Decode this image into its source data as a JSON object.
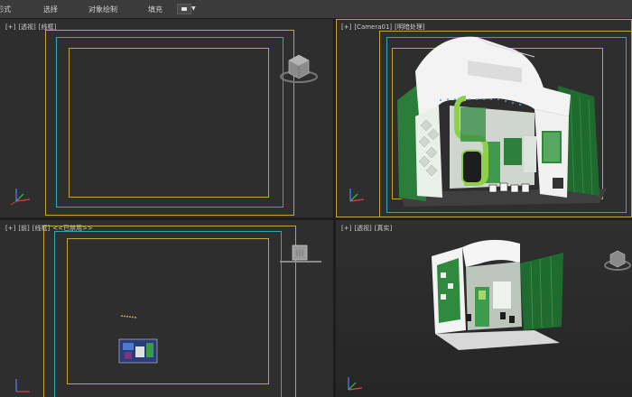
{
  "ribbon": {
    "tabs": [
      "形式",
      "选择",
      "对象绘制",
      "填充"
    ]
  },
  "viewports": {
    "top_left": {
      "labels": [
        "[+]",
        "[透视]",
        "[线框]"
      ]
    },
    "top_right": {
      "labels": [
        "[+]",
        "[Camera01]",
        "[明暗处理]"
      ]
    },
    "bottom_left": {
      "labels": [
        "[+]",
        "[前]",
        "[线框]",
        "<<已禁用>>"
      ]
    },
    "bottom_right": {
      "labels": [
        "[+]",
        "[透视]",
        "[真实]"
      ]
    }
  },
  "colors": {
    "safe_frame": "#c9a23a",
    "action_safe": "#2ba9b9",
    "booth_green": "#2e8b3e",
    "booth_white": "#f2f2f2",
    "lime_accent": "#8fd04a"
  }
}
